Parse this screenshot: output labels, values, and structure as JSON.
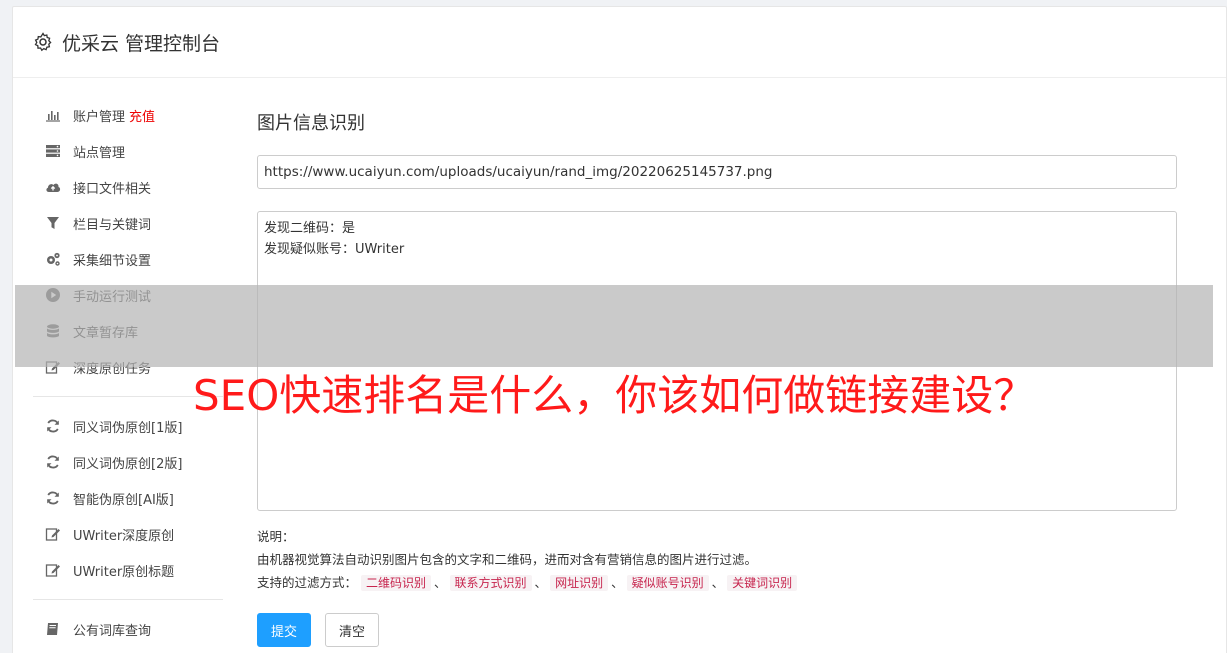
{
  "header": {
    "title": "优采云 管理控制台",
    "icon": "gear-icon"
  },
  "sidebar": {
    "group1": [
      {
        "label": "账户管理",
        "badge": "充值",
        "icon": "bar-chart-icon"
      },
      {
        "label": "站点管理",
        "icon": "server-icon"
      },
      {
        "label": "接口文件相关",
        "icon": "cloud-upload-icon"
      },
      {
        "label": "栏目与关键词",
        "icon": "filter-icon"
      },
      {
        "label": "采集细节设置",
        "icon": "gears-icon"
      },
      {
        "label": "手动运行测试",
        "icon": "play-circle-icon"
      },
      {
        "label": "文章暂存库",
        "icon": "database-icon"
      },
      {
        "label": "深度原创任务",
        "icon": "edit-icon"
      }
    ],
    "group2": [
      {
        "label": "同义词伪原创[1版]",
        "icon": "refresh-icon"
      },
      {
        "label": "同义词伪原创[2版]",
        "icon": "refresh-icon"
      },
      {
        "label": "智能伪原创[AI版]",
        "icon": "refresh-icon"
      },
      {
        "label": "UWriter深度原创",
        "icon": "edit-icon"
      },
      {
        "label": "UWriter原创标题",
        "icon": "edit-icon"
      }
    ],
    "group3": [
      {
        "label": "公有词库查询",
        "icon": "book-icon"
      }
    ]
  },
  "main": {
    "title": "图片信息识别",
    "url_value": "https://www.ucaiyun.com/uploads/ucaiyun/rand_img/20220625145737.png",
    "result_lines": [
      "发现二维码：是",
      "发现疑似账号：UWriter"
    ],
    "note_label": "说明：",
    "note_desc": "由机器视觉算法自动识别图片包含的文字和二维码，进而对含有营销信息的图片进行过滤。",
    "filter_prefix": "支持的过滤方式：",
    "filters": [
      "二维码识别",
      "联系方式识别",
      "网址识别",
      "疑似账号识别",
      "关键词识别"
    ],
    "filter_sep": "、",
    "submit_label": "提交",
    "clear_label": "清空"
  },
  "overlay": {
    "text": "SEO快速排名是什么，你该如何做链接建设？"
  }
}
